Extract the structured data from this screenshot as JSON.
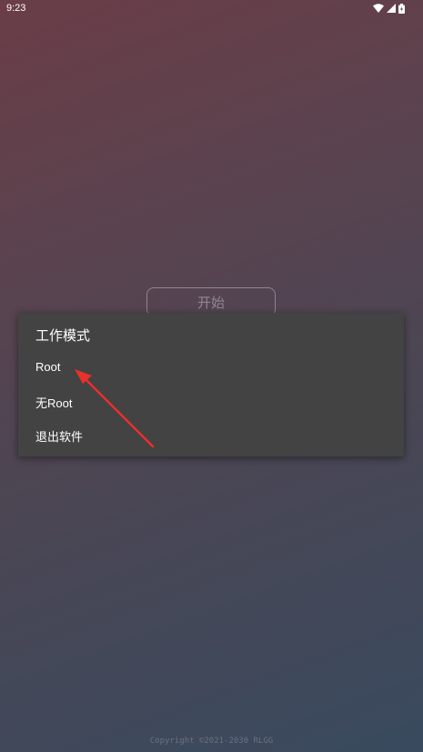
{
  "status_bar": {
    "time": "9:23",
    "icons": [
      "wifi-icon",
      "signal-icon",
      "battery-icon"
    ]
  },
  "start_button": {
    "label": "开始"
  },
  "dialog": {
    "title": "工作模式",
    "options": [
      "Root",
      "无Root",
      "退出软件"
    ]
  },
  "footer": {
    "copyright": "Copyright ©2021-2030 RLGG"
  },
  "colors": {
    "dialog_bg": "#434343",
    "annotation_arrow": "#e8312a"
  }
}
